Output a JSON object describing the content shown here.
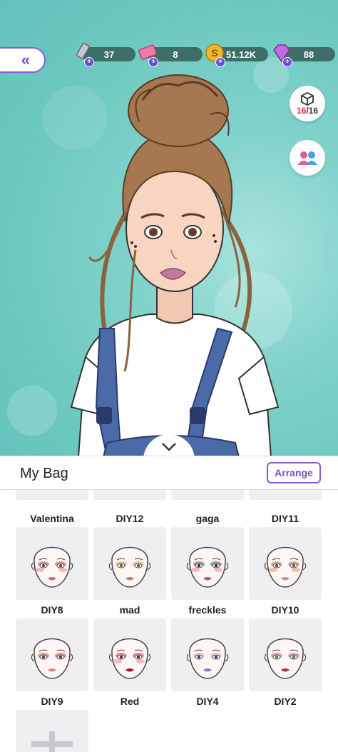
{
  "resources": [
    {
      "name": "lipstick-icon",
      "value": "37"
    },
    {
      "name": "ticket-icon",
      "value": "8"
    },
    {
      "name": "coin-icon",
      "value": "51.12K"
    },
    {
      "name": "diamond-icon",
      "value": "88"
    }
  ],
  "side": {
    "count_current": "16",
    "count_sep": "/16"
  },
  "bag": {
    "title": "My Bag",
    "arrange_label": "Arrange",
    "partial_row": [
      "Valentina",
      "DIY12",
      "gaga",
      "DIY11"
    ],
    "items": [
      {
        "label": "DIY8",
        "eye": "#7a4a3a",
        "shadow": "#c45050",
        "lip": "#c86a70",
        "blush": true
      },
      {
        "label": "mad",
        "eye": "#6b5a3a",
        "shadow": "#d7a83a",
        "lip": "#c07a70",
        "blush": false
      },
      {
        "label": "freckles",
        "eye": "#2e2e2e",
        "shadow": "#6a5a5a",
        "lip": "#a86070",
        "blush": true
      },
      {
        "label": "DIY10",
        "eye": "#6a4a3a",
        "shadow": "#b07a6a",
        "lip": "#d08a8a",
        "blush": true
      },
      {
        "label": "DIY9",
        "eye": "#5a3a3a",
        "shadow": "#c24a4a",
        "lip": "#e08878",
        "blush": false
      },
      {
        "label": "Red",
        "eye": "#5a2a2a",
        "shadow": "#e23a4a",
        "lip": "#9a1a2a",
        "blush": true
      },
      {
        "label": "DIY4",
        "eye": "#4a3a6a",
        "shadow": "#e2a0c8",
        "lip": "#a070d0",
        "blush": false
      },
      {
        "label": "DIY2",
        "eye": "#3a8a3a",
        "shadow": "#d05a8a",
        "lip": "#b03040",
        "blush": false
      }
    ]
  },
  "colors": {
    "accent": "#8a5ad6",
    "background": "#6cc8bf",
    "count_red": "#e02b3a"
  }
}
